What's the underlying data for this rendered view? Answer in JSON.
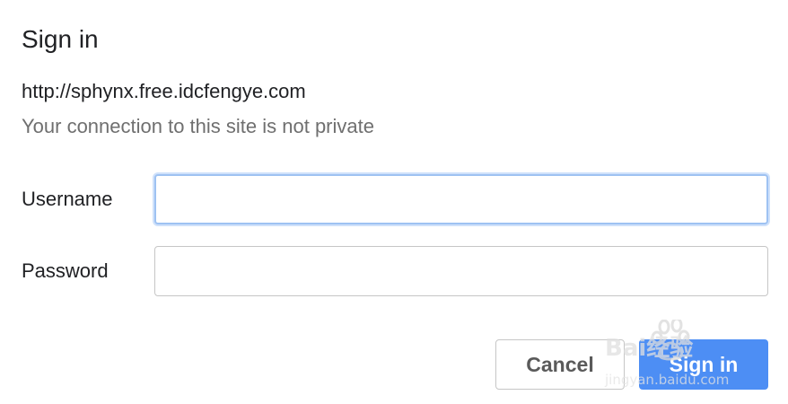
{
  "dialog": {
    "title": "Sign in",
    "origin": "http://sphynx.free.idcfengye.com",
    "warning": "Your connection to this site is not private"
  },
  "form": {
    "username_label": "Username",
    "username_value": "",
    "password_label": "Password",
    "password_value": ""
  },
  "buttons": {
    "cancel_label": "Cancel",
    "signin_label": "Sign in"
  },
  "watermark": {
    "brand_text": "Bai经验",
    "url_text": "jingyan.baidu.com"
  },
  "colors": {
    "accent": "#4d8ef4",
    "focus_ring": "#9ec2f2",
    "muted_text": "#6f6f6f",
    "border": "#c6c6c6"
  }
}
